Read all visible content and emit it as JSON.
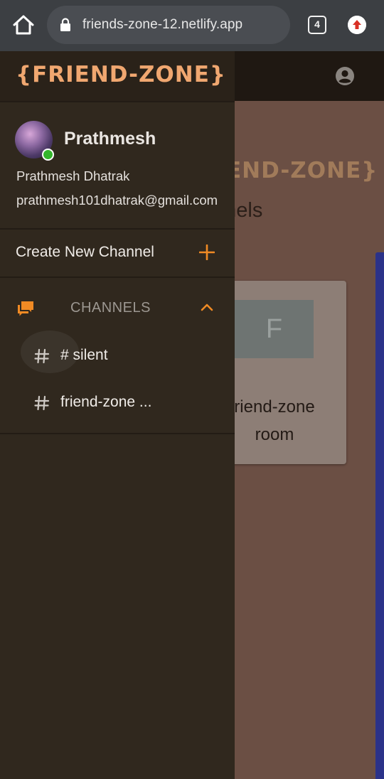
{
  "browser": {
    "url": "friends-zone-12.netlify.app",
    "tab_count": "4"
  },
  "background_page": {
    "logo_partial": "END-ZONE}",
    "heading_partial": "nnels",
    "room": {
      "avatar_letter": "F",
      "name": "riend-zone room"
    }
  },
  "drawer": {
    "logo": "{FRIEND-ZONE}",
    "user": {
      "display_name": "Prathmesh",
      "full_name": "Prathmesh Dhatrak",
      "email": "prathmesh101dhatrak@gmail.com",
      "status": "online"
    },
    "create_channel_label": "Create New Channel",
    "channels_section": {
      "title": "CHANNELS",
      "expanded": true,
      "items": [
        {
          "label": "# silent"
        },
        {
          "label": "friend-zone ..."
        }
      ]
    }
  },
  "colors": {
    "accent": "#f08a24",
    "drawer_bg": "#30281e",
    "status_online": "#33b52c",
    "page_bg": "#6b4f44"
  }
}
